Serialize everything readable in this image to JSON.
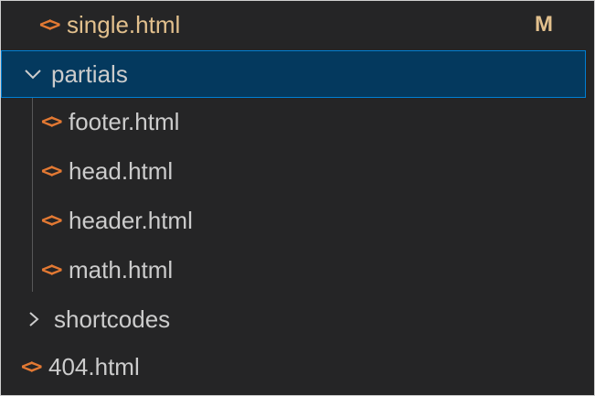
{
  "explorer": {
    "rows": [
      {
        "label": "single.html",
        "icon": "html-file-icon",
        "badge": "M"
      },
      {
        "label": "partials",
        "icon": "chevron-down-icon"
      },
      {
        "label": "footer.html",
        "icon": "html-file-icon"
      },
      {
        "label": "head.html",
        "icon": "html-file-icon"
      },
      {
        "label": "header.html",
        "icon": "html-file-icon"
      },
      {
        "label": "math.html",
        "icon": "html-file-icon"
      },
      {
        "label": "shortcodes",
        "icon": "chevron-right-icon"
      },
      {
        "label": "404.html",
        "icon": "html-file-icon"
      }
    ],
    "html_icon_glyph": "<>",
    "colors": {
      "background": "#252526",
      "selection": "#04395e",
      "selection_border": "#007fd4",
      "html_icon": "#e37933",
      "modified": "#e2c08d",
      "text": "#cccccc"
    }
  }
}
